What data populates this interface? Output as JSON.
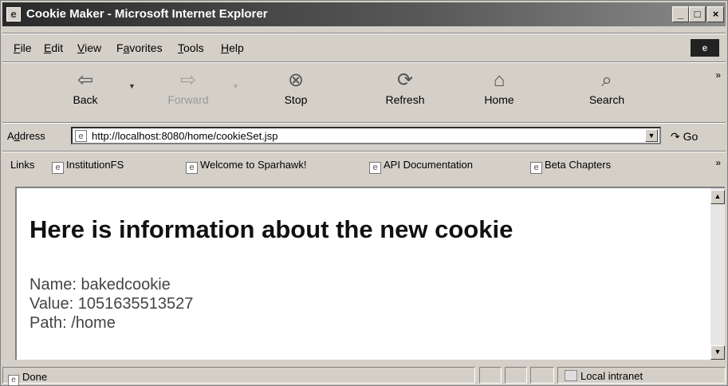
{
  "window": {
    "title": "Cookie Maker - Microsoft Internet Explorer"
  },
  "title_buttons": {
    "minimize": "_",
    "maximize": "□",
    "close": "×"
  },
  "menu": {
    "items": [
      {
        "accel": "F",
        "rest": "ile"
      },
      {
        "accel": "E",
        "rest": "dit"
      },
      {
        "accel": "V",
        "rest": "iew"
      },
      {
        "pre": "F",
        "accel": "a",
        "rest": "vorites"
      },
      {
        "accel": "T",
        "rest": "ools"
      },
      {
        "accel": "H",
        "rest": "elp"
      }
    ]
  },
  "toolbar": {
    "back": "Back",
    "forward": "Forward",
    "stop": "Stop",
    "refresh": "Refresh",
    "home": "Home",
    "search": "Search",
    "more": "»"
  },
  "address": {
    "label_pre": "A",
    "label_accel": "d",
    "label_rest": "dress",
    "url": "http://localhost:8080/home/cookieSet.jsp",
    "go": "Go"
  },
  "links": {
    "label": "Links",
    "items": [
      "InstitutionFS",
      "Welcome to Sparhawk!",
      "API Documentation",
      "Beta Chapters"
    ],
    "more": "»"
  },
  "page": {
    "heading": "Here is information about the new cookie",
    "name_line": "Name: bakedcookie",
    "value_line": "Value: 1051635513527",
    "path_line": "Path: /home"
  },
  "status": {
    "text": "Done",
    "zone": "Local intranet"
  }
}
